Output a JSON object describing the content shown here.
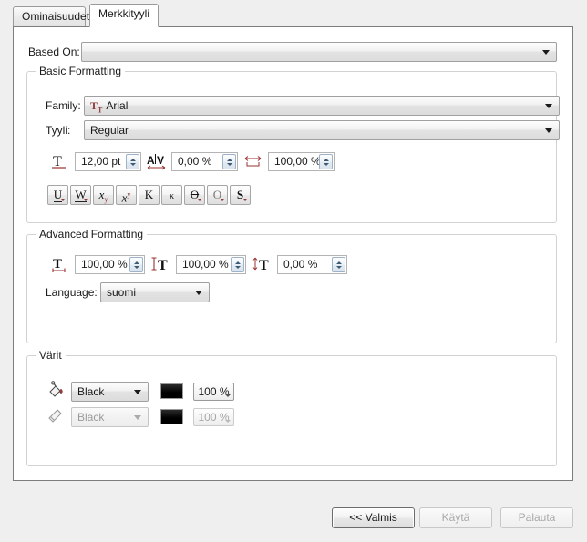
{
  "tabs": [
    {
      "label": "Ominaisuudet",
      "active": false
    },
    {
      "label": "Merkkityyli",
      "active": true
    }
  ],
  "based_on": {
    "label": "Based On:",
    "value": "",
    "placeholder": ""
  },
  "basic_formatting": {
    "title": "Basic Formatting",
    "family_label": "Family:",
    "family_value": "Arial",
    "family_icon": "truetype-icon",
    "style_label": "Tyyli:",
    "style_value": "Regular",
    "font_size": {
      "icon": "font-size-icon",
      "value": "12,00 pt"
    },
    "tracking": {
      "icon": "tracking-icon",
      "value": "0,00 %"
    },
    "word_tracking": {
      "icon": "word-tracking-icon",
      "value": "100,00 %"
    },
    "style_buttons": [
      {
        "name": "underline-button",
        "glyph": "U"
      },
      {
        "name": "word-underline-button",
        "glyph": "W"
      },
      {
        "name": "subscript-button",
        "glyph": "x"
      },
      {
        "name": "superscript-button",
        "glyph": "x"
      },
      {
        "name": "all-caps-button",
        "glyph": "K"
      },
      {
        "name": "small-caps-button",
        "glyph": "κ"
      },
      {
        "name": "strikethrough-button",
        "glyph": "S"
      },
      {
        "name": "outline-button",
        "glyph": "O"
      },
      {
        "name": "shadow-button",
        "glyph": "S"
      }
    ]
  },
  "advanced_formatting": {
    "title": "Advanced Formatting",
    "width_scale": {
      "icon": "horizontal-scale-icon",
      "value": "100,00 %"
    },
    "height_scale": {
      "icon": "vertical-scale-icon",
      "value": "100,00 %"
    },
    "baseline_offset": {
      "icon": "baseline-offset-icon",
      "value": "0,00 %"
    },
    "language_label": "Language:",
    "language_value": "suomi"
  },
  "colors": {
    "title": "Värit",
    "fill": {
      "icon": "fill-bucket-icon",
      "color": "Black",
      "swatch_hex": "#000000",
      "shade": "100 %",
      "disabled": false
    },
    "stroke": {
      "icon": "stroke-pen-icon",
      "color": "Black",
      "swatch_hex": "#000000",
      "shade": "100 %",
      "disabled": true
    }
  },
  "footer": {
    "done_label": "<< Valmis",
    "apply_label": "Käytä",
    "reset_label": "Palauta"
  }
}
